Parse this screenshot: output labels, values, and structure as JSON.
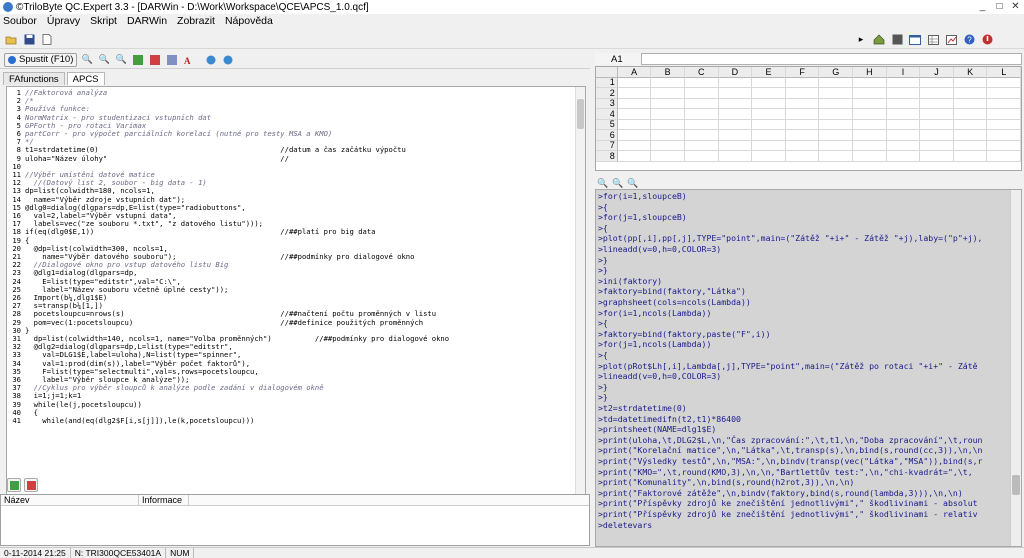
{
  "window": {
    "title": "©TriloByte QC.Expert 3.3 - [DARWin - D:\\Work\\Workspace\\QCE\\APCS_1.0.qcf]",
    "controls": [
      "_",
      "□",
      "✕"
    ]
  },
  "menu": [
    {
      "label": "Soubor"
    },
    {
      "label": "Úpravy"
    },
    {
      "label": "Skript"
    },
    {
      "label": "DARWin"
    },
    {
      "label": "Zobrazit"
    },
    {
      "label": "Nápověda"
    }
  ],
  "toolbar": {
    "run_label": "Spustit (F10)"
  },
  "tabs": [
    {
      "label": "FAfunctions"
    },
    {
      "label": "APCS"
    }
  ],
  "editor": {
    "lines": [
      {
        "n": "1",
        "t": "//Faktorová analýza",
        "c": "cm"
      },
      {
        "n": "2",
        "t": "/*",
        "c": "cm"
      },
      {
        "n": "3",
        "t": "Použivá funkce:",
        "c": "cm"
      },
      {
        "n": "4",
        "t": "NormMatrix - pro studentizaci vstupních dat",
        "c": "cm"
      },
      {
        "n": "5",
        "t": "GPForth - pro rotaci Varimax",
        "c": "cm"
      },
      {
        "n": "6",
        "t": "partCorr - pro výpočet parciálních korelací (nutné pro testy MSA a KMO)",
        "c": "cm"
      },
      {
        "n": "7",
        "t": "*/",
        "c": "cm"
      },
      {
        "n": "8",
        "t": "t1=strdatetime(0)                                          //datum a čas začátku výpočtu",
        "c": "st"
      },
      {
        "n": "9",
        "t": "uloha=\"Název úlohy\"                                        //",
        "c": "st"
      },
      {
        "n": "10",
        "t": "",
        "c": "st"
      },
      {
        "n": "11",
        "t": "//Výběr umístění datové matice",
        "c": "cm"
      },
      {
        "n": "12",
        "t": "  //(Datový list 2, soubor - big data - 1)",
        "c": "cm"
      },
      {
        "n": "13",
        "t": "dp=list(colwidth=180, ncols=1,",
        "c": "st"
      },
      {
        "n": "14",
        "t": "  name=\"Výběr zdroje vstupních dat\");",
        "c": "st"
      },
      {
        "n": "15",
        "t": "@dlg0=dialog(dlgpars=dp,E=list(type=\"radiobuttons\",",
        "c": "st"
      },
      {
        "n": "16",
        "t": "  val=2,label=\"Výběr vstupní data\",",
        "c": "st"
      },
      {
        "n": "17",
        "t": "  labels=vec(\"ze souboru *.txt\", \"z datového listu\")));",
        "c": "st"
      },
      {
        "n": "18",
        "t": "if(eq(dlg0$E,1))                                           //##platí pro big data",
        "c": "st"
      },
      {
        "n": "19",
        "t": "{",
        "c": "st"
      },
      {
        "n": "20",
        "t": "  @dp=list(colwidth=300, ncols=1,",
        "c": "st"
      },
      {
        "n": "21",
        "t": "    name=\"Výběr datového souboru\");                        //##podmínky pro dialogové okno",
        "c": "st"
      },
      {
        "n": "22",
        "t": "  //Dialogové okno pro vstup datového listu Big",
        "c": "cm"
      },
      {
        "n": "23",
        "t": "  @dlg1=dialog(dlgpars=dp,",
        "c": "st"
      },
      {
        "n": "24",
        "t": "    E=list(type=\"editstr\",val=\"C:\\\",",
        "c": "st"
      },
      {
        "n": "25",
        "t": "    label=\"Název souboru včetně úplné cesty\"));",
        "c": "st"
      },
      {
        "n": "26",
        "t": "  Import(b¼,dlg1$E)",
        "c": "st"
      },
      {
        "n": "27",
        "t": "  s=transp(b¼[1,])",
        "c": "st"
      },
      {
        "n": "28",
        "t": "  pocetsloupcu=nrows(s)                                    //##načtení počtu proměnných v listu",
        "c": "st"
      },
      {
        "n": "29",
        "t": "  pom=vec(1:pocetsloupcu)                                  //##definice použitých proměnných",
        "c": "st"
      },
      {
        "n": "30",
        "t": "}",
        "c": "st"
      },
      {
        "n": "31",
        "t": "  dp=list(colwidth=140, ncols=1, name=\"Volba proměnných\")          //##podmínky pro dialogové okno",
        "c": "st"
      },
      {
        "n": "32",
        "t": "  @dlg2=dialog(dlgpars=dp,L=list(type=\"editstr\",",
        "c": "st"
      },
      {
        "n": "33",
        "t": "    val=DLG1$E,label=uloha),N=list(type=\"spinner\",",
        "c": "st"
      },
      {
        "n": "34",
        "t": "    val=1:prod(dim(s)),label=\"Výběr počet faktorů\"),",
        "c": "st"
      },
      {
        "n": "35",
        "t": "    F=list(type=\"selectmulti\",val=s,rows=pocetsloupcu,",
        "c": "st"
      },
      {
        "n": "36",
        "t": "    label=\"Výběr sloupce k analýze\"));",
        "c": "st"
      },
      {
        "n": "37",
        "t": "  //Cyklus pro výběr sloupců k analýze podle zadání v dialogovém okně",
        "c": "cm"
      },
      {
        "n": "38",
        "t": "  i=1;j=1;k=1",
        "c": "st"
      },
      {
        "n": "39",
        "t": "  while(le(j,pocetsloupcu))",
        "c": "st"
      },
      {
        "n": "40",
        "t": "  {",
        "c": "st"
      },
      {
        "n": "41",
        "t": "    while(and(eq(dlg2$F[i,s[j]]),le(k,pocetsloupcu)))",
        "c": "st"
      }
    ]
  },
  "list_headers": [
    "Název",
    "Informace"
  ],
  "status": {
    "datetime": "0-11-2014 21:25",
    "serial": "N: TRI300QCE53401A",
    "mode": "NUM"
  },
  "sheet": {
    "cell_ref": "A1",
    "formula": "",
    "columns": [
      "A",
      "B",
      "C",
      "D",
      "E",
      "F",
      "G",
      "H",
      "I",
      "J",
      "K",
      "L"
    ],
    "rows": [
      "1",
      "2",
      "3",
      "4",
      "5",
      "6",
      "7",
      "8"
    ]
  },
  "console": {
    "lines": [
      ">for(i=1,sloupceB)",
      ">{",
      ">for(j=1,sloupceB)",
      ">{",
      ">plot(pp[,i],pp[,j],TYPE=\"point\",main=(\"Zátěž \"+i+\" - Zátěž \"+j),laby=(\"p\"+j),",
      ">lineadd(v=0,h=0,COLOR=3)",
      ">}",
      ">}",
      ">ini(faktory)",
      ">faktory=bind(faktory,\"Látka\")",
      ">graphsheet(cols=ncols(Lambda))",
      ">for(i=1,ncols(Lambda))",
      ">{",
      ">faktory=bind(faktory,paste(\"F\",i))",
      ">for(j=1,ncols(Lambda))",
      ">{",
      ">plot(pRot$Lh[,i],Lambda[,j],TYPE=\"point\",main=(\"Zátěž po rotaci \"+i+\" - Zátě",
      ">lineadd(v=0,h=0,COLOR=3)",
      ">}",
      ">}",
      ">t2=strdatetime(0)",
      ">td=datetimedifn(t2,t1)*86400",
      ">printsheet(NAME=dlg1$E)",
      ">print(uloha,\\t,DLG2$L,\\n,\"Čas zpracování:\",\\t,t1,\\n,\"Doba zpracování\",\\t,roun",
      ">print(\"Korelační matice\",\\n,\"Látka\",\\t,transp(s),\\n,bind(s,round(cc,3)),\\n,\\n",
      ">print(\"Výsledky testů\",\\n,\"MSA:\",\\n,bindv(transp(vec(\"Látka\",\"MSA\")),bind(s,r",
      ">print(\"KMO=\",\\t,round(KMO,3),\\n,\\n,\"Bartlettův test:\",\\n,\"chi-kvadrát=\",\\t,",
      ">print(\"Komunality\",\\n,bind(s,round(h2rot,3)),\\n,\\n)",
      ">print(\"Faktorové zátěže\",\\n,bindv(faktory,bind(s,round(lambda,3))),\\n,\\n)",
      ">print(\"Příspěvky zdrojů ke znečištění jednotlivými\",\" škodlivinami - absolut",
      ">print(\"Příspěvky zdrojů ke znečištění jednotlivými\",\" škodlivinami - relativ",
      ">deletevars"
    ]
  },
  "colors": {
    "console_bg": "#d4d4d4",
    "keyword": "#1a1aa0",
    "comment": "#6b6b8a"
  }
}
